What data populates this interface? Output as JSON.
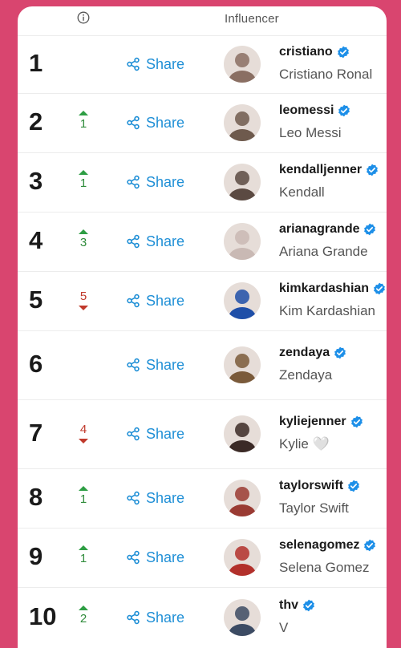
{
  "header": {
    "influencer_label": "Influencer",
    "info_icon": "info-icon"
  },
  "colors": {
    "brand_background": "#d9456f",
    "share_accent": "#1f8fd6",
    "rank_up": "#2e9e44",
    "rank_down": "#c0392b",
    "verified_badge": "#1d8fe8"
  },
  "rows": [
    {
      "rank": "1",
      "change": "",
      "direction": "none",
      "share_label": "Share",
      "handle": "cristiano",
      "name": "Cristiano Ronal",
      "verified": true,
      "avatar_color": "#8a6f63"
    },
    {
      "rank": "2",
      "change": "1",
      "direction": "up",
      "share_label": "Share",
      "handle": "leomessi",
      "name": "Leo Messi",
      "verified": true,
      "avatar_color": "#6e5a4d"
    },
    {
      "rank": "3",
      "change": "1",
      "direction": "up",
      "share_label": "Share",
      "handle": "kendalljenner",
      "name": "Kendall",
      "verified": true,
      "avatar_color": "#5b4a42"
    },
    {
      "rank": "4",
      "change": "3",
      "direction": "up",
      "share_label": "Share",
      "handle": "arianagrande",
      "name": "Ariana Grande",
      "verified": true,
      "avatar_color": "#c9b9b4"
    },
    {
      "rank": "5",
      "change": "5",
      "direction": "down",
      "share_label": "Share",
      "handle": "kimkardashian",
      "name": "Kim Kardashian",
      "verified": true,
      "avatar_color": "#1f4fa8"
    },
    {
      "rank": "6",
      "change": "",
      "direction": "none",
      "share_label": "Share",
      "handle": "zendaya",
      "name": "Zendaya",
      "verified": true,
      "avatar_color": "#7a5a3a"
    },
    {
      "rank": "7",
      "change": "4",
      "direction": "down",
      "share_label": "Share",
      "handle": "kyliejenner",
      "name": "Kylie 🤍",
      "verified": true,
      "avatar_color": "#3b2a26"
    },
    {
      "rank": "8",
      "change": "1",
      "direction": "up",
      "share_label": "Share",
      "handle": "taylorswift",
      "name": "Taylor Swift",
      "verified": true,
      "avatar_color": "#9a3b33"
    },
    {
      "rank": "9",
      "change": "1",
      "direction": "up",
      "share_label": "Share",
      "handle": "selenagomez",
      "name": "Selena Gomez",
      "verified": true,
      "avatar_color": "#b2302b"
    },
    {
      "rank": "10",
      "change": "2",
      "direction": "up",
      "share_label": "Share",
      "handle": "thv",
      "name": "V",
      "verified": true,
      "avatar_color": "#3c4b63"
    }
  ]
}
